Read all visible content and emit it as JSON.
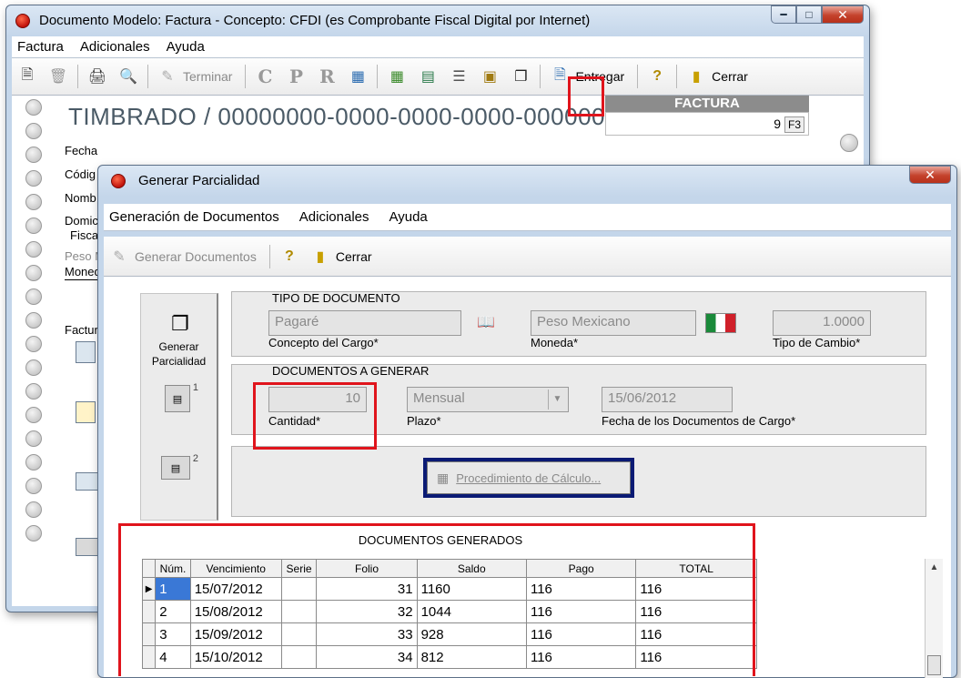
{
  "back_window": {
    "title": "Documento Modelo: Factura - Concepto: CFDI (es Comprobante Fiscal Digital por Internet)",
    "menu": [
      "Factura",
      "Adicionales",
      "Ayuda"
    ],
    "toolbar": {
      "terminar": "Terminar",
      "letters": [
        "C",
        "P",
        "R"
      ],
      "entregar": "Entregar",
      "cerrar": "Cerrar"
    },
    "timbrado": "TIMBRADO / 00000000-0000-0000-0000-000000",
    "factura_label": "FACTURA",
    "factura_number": "9",
    "factura_key": "F3",
    "labels": {
      "fecha": "Fecha",
      "codigo": "Códig",
      "nombre": "Nomb",
      "domicilio": "Domic",
      "fiscal": "Fisca",
      "peso": "Peso M",
      "moneda": "Moned",
      "factur": "Factur"
    }
  },
  "front_window": {
    "title": "Generar Parcialidad",
    "menu": [
      "Generación de Documentos",
      "Adicionales",
      "Ayuda"
    ],
    "toolbar": {
      "generar_documentos": "Generar Documentos",
      "cerrar": "Cerrar"
    },
    "left_panel": {
      "label_line1": "Generar",
      "label_line2": "Parcialidad",
      "doc1_index": "1",
      "doc2_index": "2"
    },
    "tipo_documento": {
      "title": "TIPO DE DOCUMENTO",
      "concepto_value": "Pagaré",
      "concepto_label": "Concepto del Cargo*",
      "moneda_value": "Peso Mexicano",
      "moneda_label": "Moneda*",
      "tipo_cambio_value": "1.0000",
      "tipo_cambio_label": "Tipo de Cambio*"
    },
    "documentos_generar": {
      "title": "DOCUMENTOS A GENERAR",
      "cantidad_value": "10",
      "cantidad_label": "Cantidad*",
      "plazo_value": "Mensual",
      "plazo_label": "Plazo*",
      "fecha_value": "15/06/2012",
      "fecha_label": "Fecha de los Documentos de Cargo*"
    },
    "procedimiento_button": "Procedimiento de Cálculo...",
    "generados": {
      "title": "DOCUMENTOS GENERADOS",
      "columns": [
        "Núm.",
        "Vencimiento",
        "Serie",
        "Folio",
        "Saldo",
        "Pago",
        "TOTAL"
      ],
      "rows": [
        [
          "1",
          "15/07/2012",
          "",
          "31",
          "1160",
          "116",
          "116"
        ],
        [
          "2",
          "15/08/2012",
          "",
          "32",
          "1044",
          "116",
          "116"
        ],
        [
          "3",
          "15/09/2012",
          "",
          "33",
          "928",
          "116",
          "116"
        ],
        [
          "4",
          "15/10/2012",
          "",
          "34",
          "812",
          "116",
          "116"
        ]
      ]
    }
  }
}
